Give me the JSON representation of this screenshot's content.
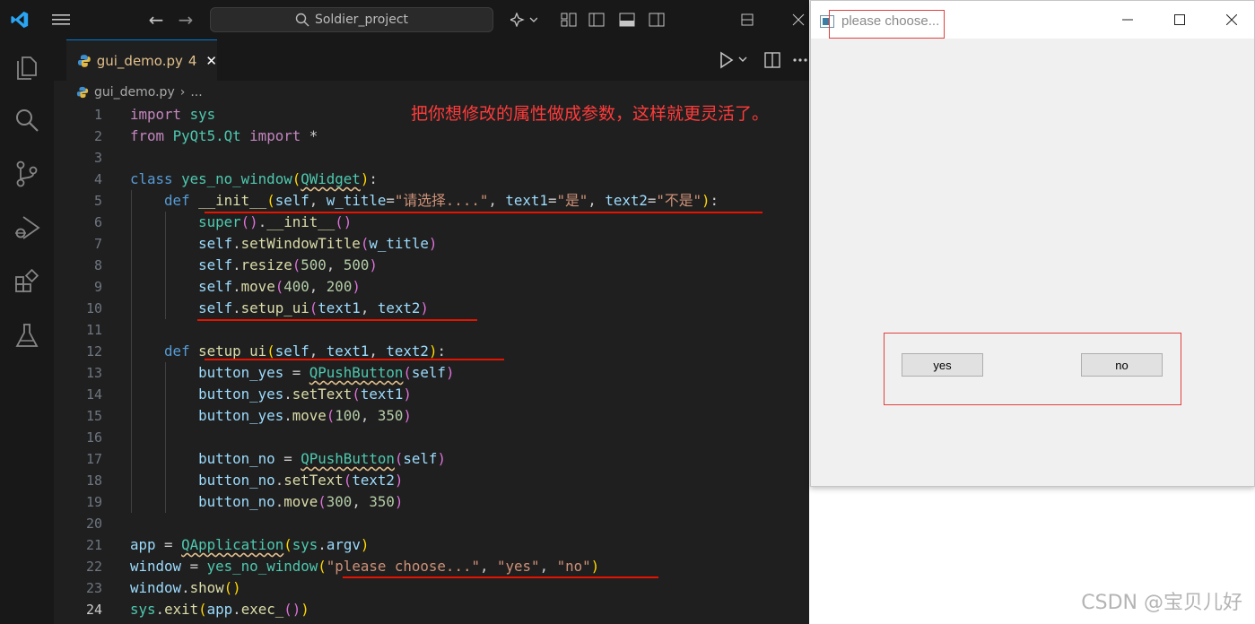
{
  "vscode": {
    "search_label": "Soldier_project",
    "tab": {
      "filename": "gui_demo.py",
      "problem_count": "4",
      "close_symbol": "✕"
    },
    "breadcrumb": {
      "file": "gui_demo.py",
      "sep": "›",
      "rest": "..."
    },
    "annotation": "把你想修改的属性做成参数，这样就更灵活了。",
    "current_line": "24"
  },
  "qt_window": {
    "title": "please choose...",
    "buttons": {
      "yes": "yes",
      "no": "no"
    }
  },
  "watermark": "CSDN @宝贝儿好",
  "colors": {
    "accent": "#0078d4",
    "annotation_red": "#e51400",
    "editor_bg": "#1f1f1f"
  }
}
